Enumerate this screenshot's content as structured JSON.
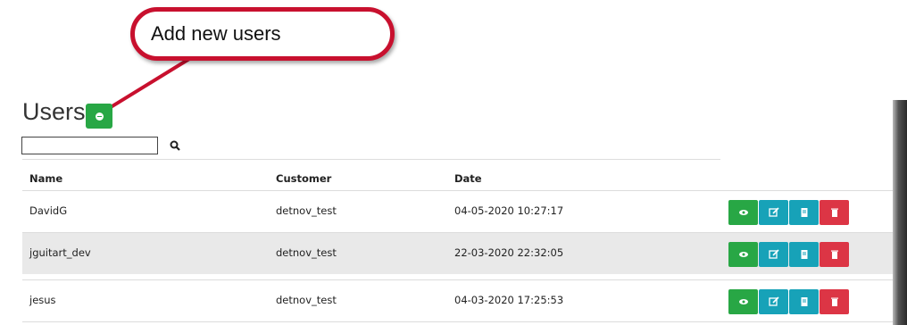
{
  "callout": {
    "text": "Add new users",
    "color": "#c8102e"
  },
  "page": {
    "title": "Users"
  },
  "search": {
    "value": "",
    "placeholder": ""
  },
  "table": {
    "columns": [
      "Name",
      "Customer",
      "Date"
    ],
    "rows": [
      {
        "name": "DavidG",
        "customer": "detnov_test",
        "date": "04-05-2020 10:27:17"
      },
      {
        "name": "jguitart_dev",
        "customer": "detnov_test",
        "date": "22-03-2020 22:32:05"
      },
      {
        "name": "jesus",
        "customer": "detnov_test",
        "date": "04-03-2020 17:25:53"
      }
    ],
    "actions": [
      {
        "name": "view-icon",
        "color": "#28a745"
      },
      {
        "name": "edit-icon",
        "color": "#17a2b8"
      },
      {
        "name": "document-icon",
        "color": "#17a2b8"
      },
      {
        "name": "trash-icon",
        "color": "#dc3545"
      }
    ]
  }
}
